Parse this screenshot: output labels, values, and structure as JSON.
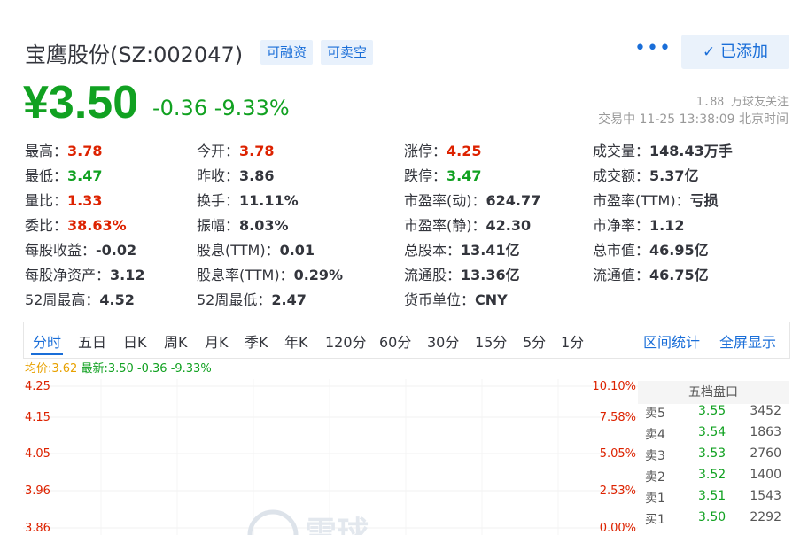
{
  "header": {
    "title": "宝鹰股份(SZ:002047)",
    "tag_margin": "可融资",
    "tag_short": "可卖空",
    "more_label": "•••",
    "added_label": "已添加"
  },
  "price": {
    "current": "¥3.50",
    "change": "-0.36",
    "change_pct": "-9.33%",
    "followers": "1.88 万球友关注",
    "status": "交易中 11-25 13:38:09 北京时间"
  },
  "quote": [
    [
      {
        "label": "最高：",
        "value": "3.78",
        "tone": "up"
      },
      {
        "label": "最低：",
        "value": "3.47",
        "tone": "down"
      },
      {
        "label": "量比：",
        "value": "1.33",
        "tone": "up"
      },
      {
        "label": "委比：",
        "value": "38.63%",
        "tone": "up"
      },
      {
        "label": "每股收益：",
        "value": "-0.02",
        "tone": ""
      },
      {
        "label": "每股净资产：",
        "value": "3.12",
        "tone": ""
      },
      {
        "label": "52周最高：",
        "value": "4.52",
        "tone": ""
      }
    ],
    [
      {
        "label": "今开：",
        "value": "3.78",
        "tone": "up"
      },
      {
        "label": "昨收：",
        "value": "3.86",
        "tone": ""
      },
      {
        "label": "换手：",
        "value": "11.11%",
        "tone": ""
      },
      {
        "label": "振幅：",
        "value": "8.03%",
        "tone": ""
      },
      {
        "label": "股息(TTM)：",
        "value": "0.01",
        "tone": ""
      },
      {
        "label": "股息率(TTM)：",
        "value": "0.29%",
        "tone": ""
      },
      {
        "label": "52周最低：",
        "value": "2.47",
        "tone": ""
      }
    ],
    [
      {
        "label": "涨停：",
        "value": "4.25",
        "tone": "up"
      },
      {
        "label": "跌停：",
        "value": "3.47",
        "tone": "down"
      },
      {
        "label": "市盈率(动)：",
        "value": "624.77",
        "tone": ""
      },
      {
        "label": "市盈率(静)：",
        "value": "42.30",
        "tone": ""
      },
      {
        "label": "总股本：",
        "value": "13.41亿",
        "tone": ""
      },
      {
        "label": "流通股：",
        "value": "13.36亿",
        "tone": ""
      },
      {
        "label": "货币单位：",
        "value": "CNY",
        "tone": ""
      }
    ],
    [
      {
        "label": "成交量：",
        "value": "148.43万手",
        "tone": ""
      },
      {
        "label": "成交额：",
        "value": "5.37亿",
        "tone": ""
      },
      {
        "label": "市盈率(TTM)：",
        "value": "亏损",
        "tone": ""
      },
      {
        "label": "市净率：",
        "value": "1.12",
        "tone": ""
      },
      {
        "label": "总市值：",
        "value": "46.95亿",
        "tone": ""
      },
      {
        "label": "流通值：",
        "value": "46.75亿",
        "tone": ""
      }
    ]
  ],
  "tabs": [
    "分时",
    "五日",
    "日K",
    "周K",
    "月K",
    "季K",
    "年K",
    "120分",
    "60分",
    "30分",
    "15分",
    "5分",
    "1分"
  ],
  "tab_links": [
    "区间统计",
    "全屏显示"
  ],
  "chart_info": {
    "avg_label": "均价:3.62",
    "latest_label": "最新:3.50 -0.36 -9.33%"
  },
  "chart_data": {
    "type": "line",
    "title": "",
    "y_left_ticks": [
      "4.25",
      "4.15",
      "4.05",
      "3.96",
      "3.86"
    ],
    "y_right_ticks": [
      "10.10%",
      "7.58%",
      "5.05%",
      "2.53%",
      "0.00%"
    ]
  },
  "orderbook": {
    "title": "五档盘口",
    "rows": [
      {
        "side": "卖5",
        "price": "3.55",
        "volume": "3452"
      },
      {
        "side": "卖4",
        "price": "3.54",
        "volume": "1863"
      },
      {
        "side": "卖3",
        "price": "3.53",
        "volume": "2760"
      },
      {
        "side": "卖2",
        "price": "3.52",
        "volume": "1400"
      },
      {
        "side": "卖1",
        "price": "3.51",
        "volume": "1543"
      },
      {
        "side": "买1",
        "price": "3.50",
        "volume": "2292"
      }
    ]
  },
  "watermark": "雪球",
  "colors": {
    "up": "#dd2200",
    "down": "#11a121",
    "accent": "#1a6ed8"
  }
}
